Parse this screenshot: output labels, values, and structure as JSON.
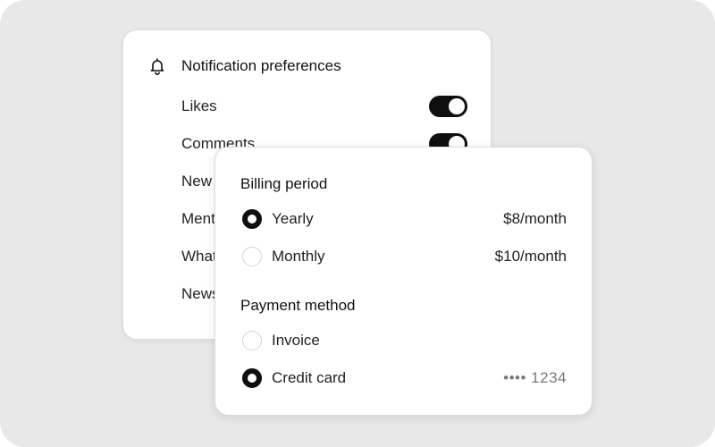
{
  "notifications": {
    "title": "Notification preferences",
    "items": [
      {
        "label": "Likes",
        "enabled": true
      },
      {
        "label": "Comments",
        "enabled": true
      },
      {
        "label": "New",
        "enabled": null
      },
      {
        "label": "Ment",
        "enabled": null
      },
      {
        "label": "What",
        "enabled": null
      },
      {
        "label": "News",
        "enabled": null
      }
    ]
  },
  "billing": {
    "billing_period": {
      "title": "Billing period",
      "options": [
        {
          "label": "Yearly",
          "price": "$8/month",
          "selected": true
        },
        {
          "label": "Monthly",
          "price": "$10/month",
          "selected": false
        }
      ]
    },
    "payment_method": {
      "title": "Payment method",
      "options": [
        {
          "label": "Invoice",
          "detail": "",
          "selected": false
        },
        {
          "label": "Credit card",
          "detail": "•••• 1234",
          "selected": true
        }
      ]
    }
  },
  "colors": {
    "background": "#e8e8e8",
    "card": "#ffffff",
    "accent": "#0f0f0f",
    "muted_text": "#7a7a7a"
  },
  "icons": {
    "notifications_header": "bell-icon"
  }
}
